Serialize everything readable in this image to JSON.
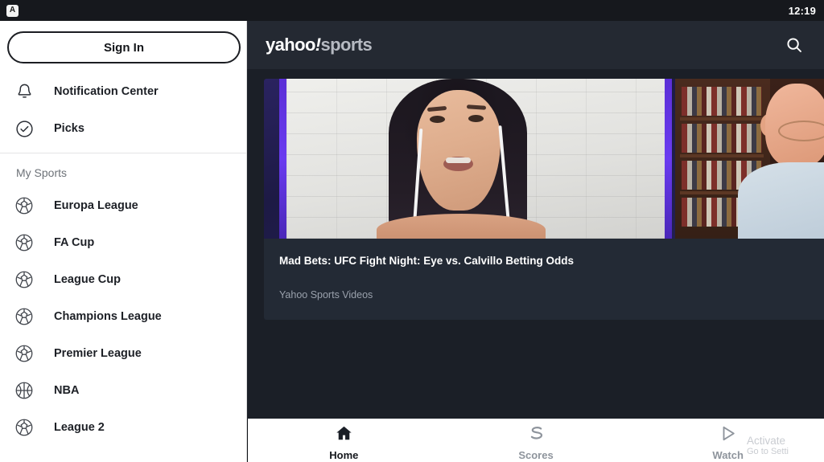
{
  "statusbar": {
    "app_glyph": "A",
    "app_glyph_icon": "app-letter-icon",
    "clock": "12:19"
  },
  "sidebar": {
    "signin_label": "Sign In",
    "menu": [
      {
        "label": "Notification Center",
        "icon": "bell-icon"
      },
      {
        "label": "Picks",
        "icon": "check-circle-icon"
      }
    ],
    "section_title": "My Sports",
    "sports": [
      {
        "label": "Europa League",
        "icon": "soccer-ball-icon"
      },
      {
        "label": "FA Cup",
        "icon": "soccer-ball-icon"
      },
      {
        "label": "League Cup",
        "icon": "soccer-ball-icon"
      },
      {
        "label": "Champions League",
        "icon": "soccer-ball-icon"
      },
      {
        "label": "Premier League",
        "icon": "soccer-ball-icon"
      },
      {
        "label": "NBA",
        "icon": "basketball-icon"
      },
      {
        "label": "League 2",
        "icon": "soccer-ball-icon"
      }
    ]
  },
  "header": {
    "logo_yahoo": "yahoo",
    "logo_bang": "!",
    "logo_sports": "sports",
    "search_icon": "search-icon"
  },
  "card": {
    "title": "Mad Bets: UFC Fight Night: Eye vs. Calvillo Betting Odds",
    "source": "Yahoo Sports Videos",
    "thumbnail_alt": "video-still-two-panel-interview"
  },
  "bottomnav": [
    {
      "label": "Home",
      "icon": "home-icon",
      "active": true
    },
    {
      "label": "Scores",
      "icon": "scores-s-icon",
      "active": false
    },
    {
      "label": "Watch",
      "icon": "play-triangle-icon",
      "active": false
    }
  ],
  "watermark": {
    "line1": "Activate",
    "line2": "Go to Setti"
  },
  "colors": {
    "app_bar": "#242932",
    "main_bg": "#1b1f27",
    "card_bg": "#232a35",
    "sidebar_bg": "#ffffff",
    "status_bg": "#16181d",
    "accent_purple": "#6a3bf0"
  }
}
